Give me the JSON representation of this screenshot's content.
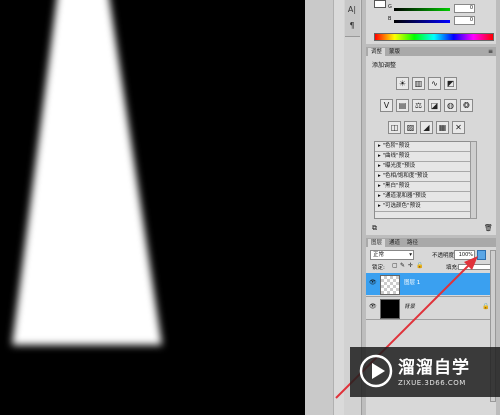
{
  "color_panel": {
    "g_label": "G",
    "g_value": "0",
    "b_label": "B",
    "b_value": "0"
  },
  "adjustments_panel": {
    "tabs": [
      "调整",
      "蒙版"
    ],
    "heading": "添加调整",
    "presets": [
      "\"色阶\"预设",
      "\"曲线\"预设",
      "\"曝光度\"预设",
      "\"色相/饱和度\"预设",
      "\"黑白\"预设",
      "\"通道混和器\"预设",
      "\"可选颜色\"预设"
    ]
  },
  "layers_panel": {
    "tabs": [
      "图层",
      "通道",
      "路径"
    ],
    "blend_mode": "正常",
    "opacity_label": "不透明度:",
    "opacity_value": "100%",
    "lock_label": "锁定:",
    "fill_label": "填充:",
    "layers": [
      {
        "name": "图层 1",
        "selected": true
      },
      {
        "name": "背景",
        "selected": false
      }
    ]
  },
  "toolstrip": {
    "icons": [
      "type-icon",
      "paragraph-icon"
    ],
    "glyphs": [
      "A|",
      "¶"
    ]
  },
  "watermark": {
    "title": "溜溜自学",
    "url": "ZIXUE.3D66.COM"
  },
  "colors": {
    "selected_layer": "#3aa0f0",
    "arrow": "#e0323a",
    "panel_bg": "#d8d8d8"
  }
}
